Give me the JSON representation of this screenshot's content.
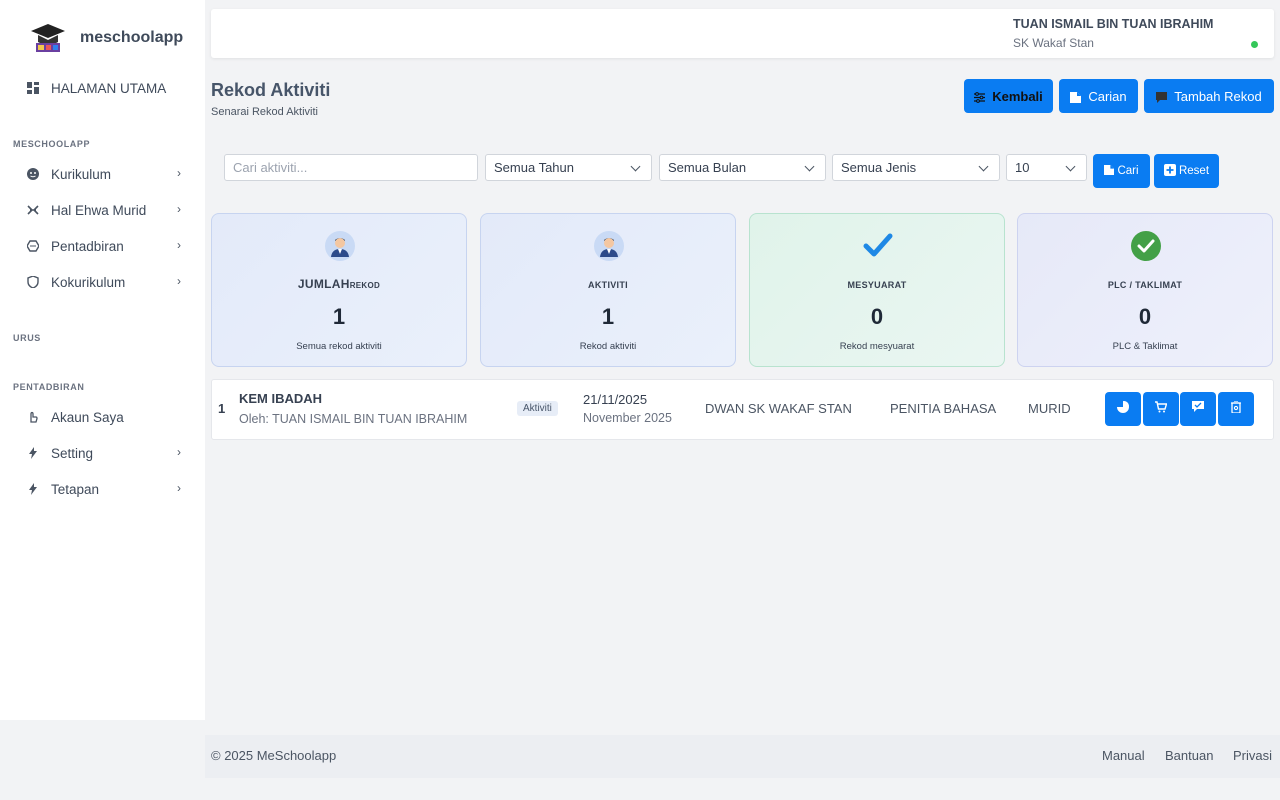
{
  "app": {
    "name": "meschoolapp"
  },
  "sidebar": {
    "home": "HALAMAN UTAMA",
    "section1": "MESCHOOLAPP",
    "items1": [
      {
        "label": "Kurikulum",
        "icon": "smiley-icon"
      },
      {
        "label": "Hal Ehwa Murid",
        "icon": "code-icon"
      },
      {
        "label": "Pentadbiran",
        "icon": "hexagon-icon"
      },
      {
        "label": "Kokurikulum",
        "icon": "shield-icon"
      }
    ],
    "section2": "URUS",
    "section3": "PENTADBIRAN",
    "items3": [
      {
        "label": "Akaun Saya",
        "icon": "hand-icon"
      },
      {
        "label": "Setting",
        "icon": "bolt-icon"
      },
      {
        "label": "Tetapan",
        "icon": "bolt-icon"
      }
    ]
  },
  "topbar": {
    "user_name": "TUAN ISMAIL BIN TUAN IBRAHIM",
    "school": "SK Wakaf Stan"
  },
  "page": {
    "title": "Rekod Aktiviti",
    "subtitle": "Senarai Rekod Aktiviti",
    "buttons": {
      "back": "Kembali",
      "search": "Carian",
      "add": "Tambah Rekod"
    }
  },
  "filters": {
    "search_placeholder": "Cari aktiviti...",
    "year": "Semua Tahun",
    "month": "Semua Bulan",
    "type": "Semua Jenis",
    "per_page": "10",
    "search_btn": "Cari",
    "reset_btn": "Reset"
  },
  "stats": [
    {
      "label": "JUMLAH",
      "label_suffix": "REKOD",
      "value": "1",
      "desc": "Semua rekod aktiviti",
      "icon": "user-avatar-icon"
    },
    {
      "label": "AKTIVITI",
      "value": "1",
      "desc": "Rekod aktiviti",
      "icon": "user-avatar-icon"
    },
    {
      "label": "MESYUARAT",
      "value": "0",
      "desc": "Rekod mesyuarat",
      "icon": "checkmark-icon"
    },
    {
      "label": "PLC / TAKLIMAT",
      "value": "0",
      "desc": "PLC & Taklimat",
      "icon": "check-circle-icon"
    }
  ],
  "records": [
    {
      "no": "1",
      "title": "KEM IBADAH",
      "by": "Oleh: TUAN ISMAIL BIN TUAN IBRAHIM",
      "type": "Aktiviti",
      "date": "21/11/2025",
      "month": "November 2025",
      "venue": "DWAN SK WAKAF STAN",
      "committee": "PENITIA BAHASA",
      "target": "MURID"
    }
  ],
  "footer": {
    "copyright": "© 2025 MeSchoolapp",
    "links": [
      "Manual",
      "Bantuan",
      "Privasi"
    ]
  },
  "colors": {
    "primary": "#0a7cf2",
    "online": "#34c759"
  }
}
